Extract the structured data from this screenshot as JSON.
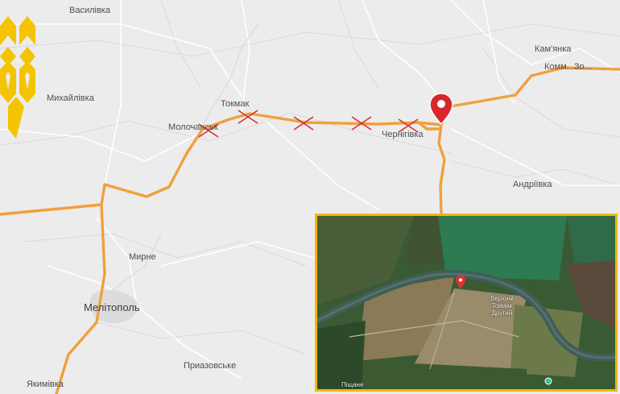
{
  "towns": {
    "vasylivka": "Василівка",
    "mykhailivka": "Михайлівка",
    "tokmak": "Токмак",
    "molochansk": "Молочанськ",
    "chernihivka": "Чернігівка",
    "kamianka": "Кам'янка",
    "kommunar": "Комм...Зо...",
    "andriivka": "Андріївка",
    "myrne": "Мирне",
    "melitopol": "Мелітополь",
    "pryazovske": "Приазовське",
    "yakymivka": "Якимівка"
  },
  "inset": {
    "label_line1": "Верхній",
    "label_line2": "Токмак",
    "label_line3": "Другий",
    "bottom_label": "Піщане"
  },
  "colors": {
    "route": "#f0a03c",
    "cross": "#d2322d",
    "pin": "#d8282d",
    "inset_border": "#f2b705",
    "logo": "#f5c400"
  },
  "markers": {
    "cross_count": 5,
    "pin": "location-pin-icon"
  }
}
